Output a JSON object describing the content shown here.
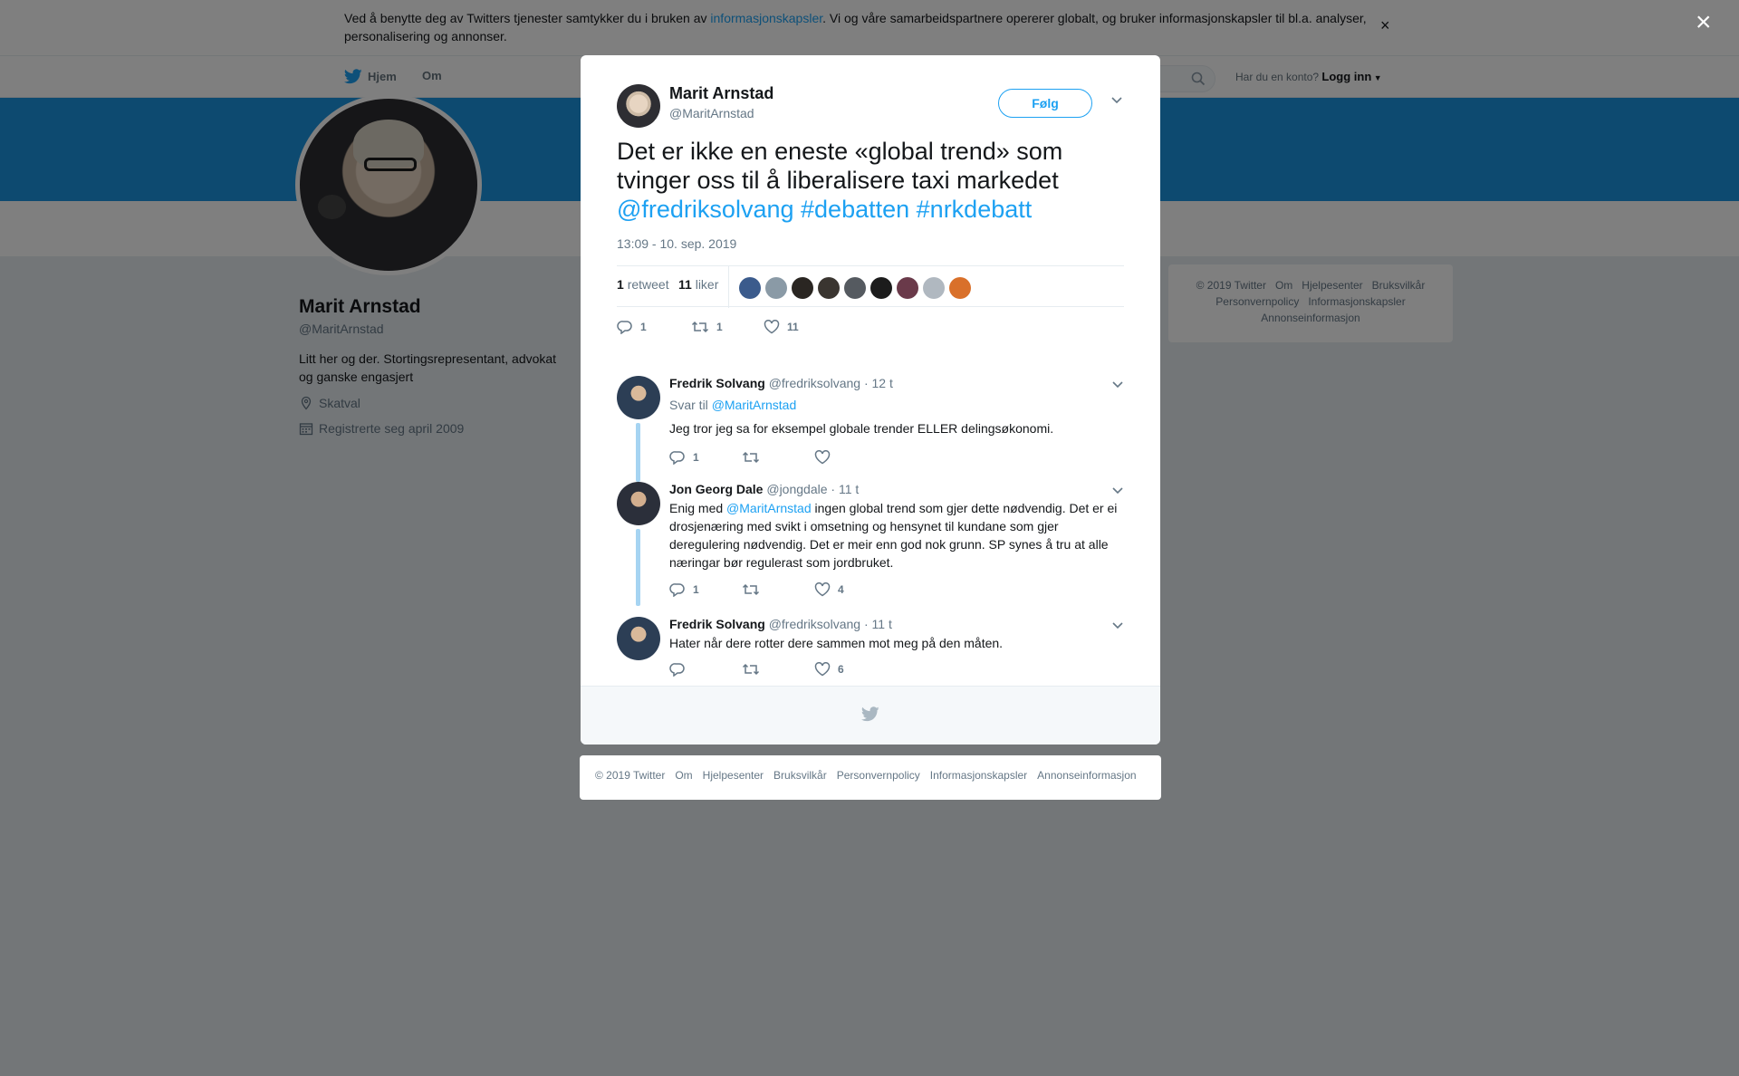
{
  "cookie": {
    "text_before": "Ved å benytte deg av Twitters tjenester samtykker du i bruken av ",
    "link": "informasjonskapsler",
    "text_after": ". Vi og våre samarbeidspartnere opererer globalt, og bruker informasjonskapsler til bl.a. analyser, personalisering og annonser.",
    "close": "×"
  },
  "nav": {
    "home": "Hjem",
    "about": "Om",
    "account_prompt": "Har du en konto?",
    "login": "Logg inn"
  },
  "profile": {
    "name": "Marit Arnstad",
    "handle": "@MaritArnstad",
    "bio": "Litt her og der. Stortingsrepresentant, advokat og ganske engasjert",
    "location": "Skatval",
    "joined": "Registrerte seg april 2009"
  },
  "side_footer": [
    "© 2019 Twitter",
    "Om",
    "Hjelpesenter",
    "Bruksvilkår",
    "Personvernpolicy",
    "Informasjonskapsler",
    "Annonseinformasjon"
  ],
  "overlay_close": "×",
  "tweet": {
    "name": "Marit Arnstad",
    "handle": "@MaritArnstad",
    "follow": "Følg",
    "text": "Det er ikke en eneste «global trend» som tvinger oss til å liberalisere taxi markedet",
    "mention": "@fredriksolvang",
    "tag1": "#debatten",
    "tag2": "#nrkdebatt",
    "time": "13:09 - 10. sep. 2019",
    "retweets": "1",
    "retweets_label": "retweet",
    "likes": "11",
    "likes_label": "liker",
    "reply_count": "1",
    "retweet_count": "1",
    "like_count": "11",
    "liker_colors": [
      "#3b5b8c",
      "#8a9aa6",
      "#2a2622",
      "#3a3530",
      "#555a60",
      "#1c1c1c",
      "#6a3a4a",
      "#b0b8c0",
      "#d9702a"
    ]
  },
  "replies": [
    {
      "name": "Fredrik Solvang",
      "handle": "@fredriksolvang",
      "time": "· 12 t",
      "reply_to_label": "Svar til",
      "reply_to": "@MaritArnstad",
      "text": "Jeg tror jeg sa for eksempel globale trender ELLER delingsøkonomi.",
      "reply_count": "1",
      "retweet_count": "",
      "like_count": ""
    },
    {
      "name": "Jon Georg Dale",
      "handle": "@jongdale",
      "time": "· 11 t",
      "text_before": "Enig med ",
      "mention": "@MaritArnstad",
      "text_after": " ingen global trend som gjer dette nødvendig. Det er ei drosjenæring med svikt i omsetning og hensynet til kundane som gjer deregulering nødvendig. Det er meir enn god nok grunn. SP synes å tru at alle næringar bør regulerast som jordbruket.",
      "reply_count": "1",
      "retweet_count": "",
      "like_count": "4"
    },
    {
      "name": "Fredrik Solvang",
      "handle": "@fredriksolvang",
      "time": "· 11 t",
      "text": "Hater når dere rotter dere sammen mot meg på den måten.",
      "reply_count": "",
      "retweet_count": "",
      "like_count": "6"
    }
  ],
  "bottom_footer": [
    "© 2019 Twitter",
    "Om",
    "Hjelpesenter",
    "Bruksvilkår",
    "Personvernpolicy",
    "Informasjonskapsler",
    "Annonseinformasjon"
  ],
  "colors": {
    "accent": "#1da1f2",
    "banner": "#1b95e0",
    "thread": "#a6d4f2"
  }
}
